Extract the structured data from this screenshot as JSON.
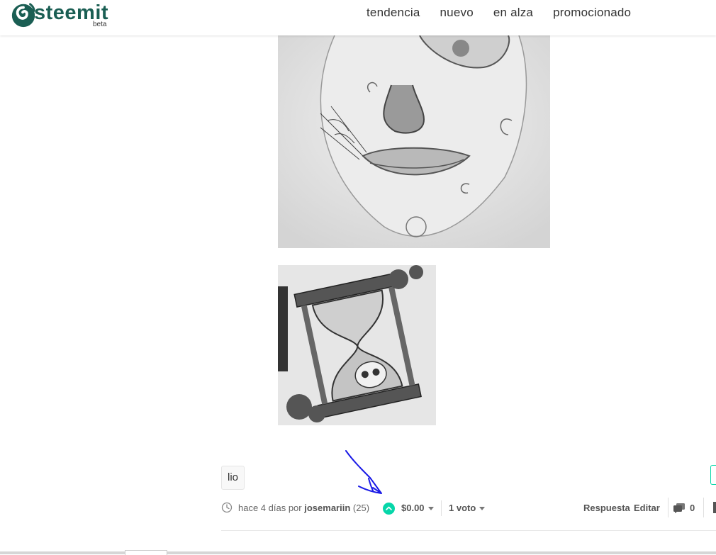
{
  "header": {
    "logo_text": "steemit",
    "logo_beta": "beta",
    "nav": [
      {
        "label": "tendencia"
      },
      {
        "label": "nuevo"
      },
      {
        "label": "en alza"
      },
      {
        "label": "promocionado"
      }
    ]
  },
  "post": {
    "tag": "lio",
    "time": "hace 4 días por",
    "author": "josemariin",
    "reputation": "(25)",
    "payout": "$0.00",
    "votes": "1 voto",
    "reply_label": "Respuesta",
    "edit_label": "Editar",
    "comments_count": "0"
  },
  "colors": {
    "brand": "#1a5e53",
    "upvote": "#06d6a9",
    "annotation": "#1a1ae6"
  },
  "icons": [
    "steemit-logo-icon",
    "clock-icon",
    "upvote-icon",
    "caret-down-icon",
    "comments-icon"
  ]
}
